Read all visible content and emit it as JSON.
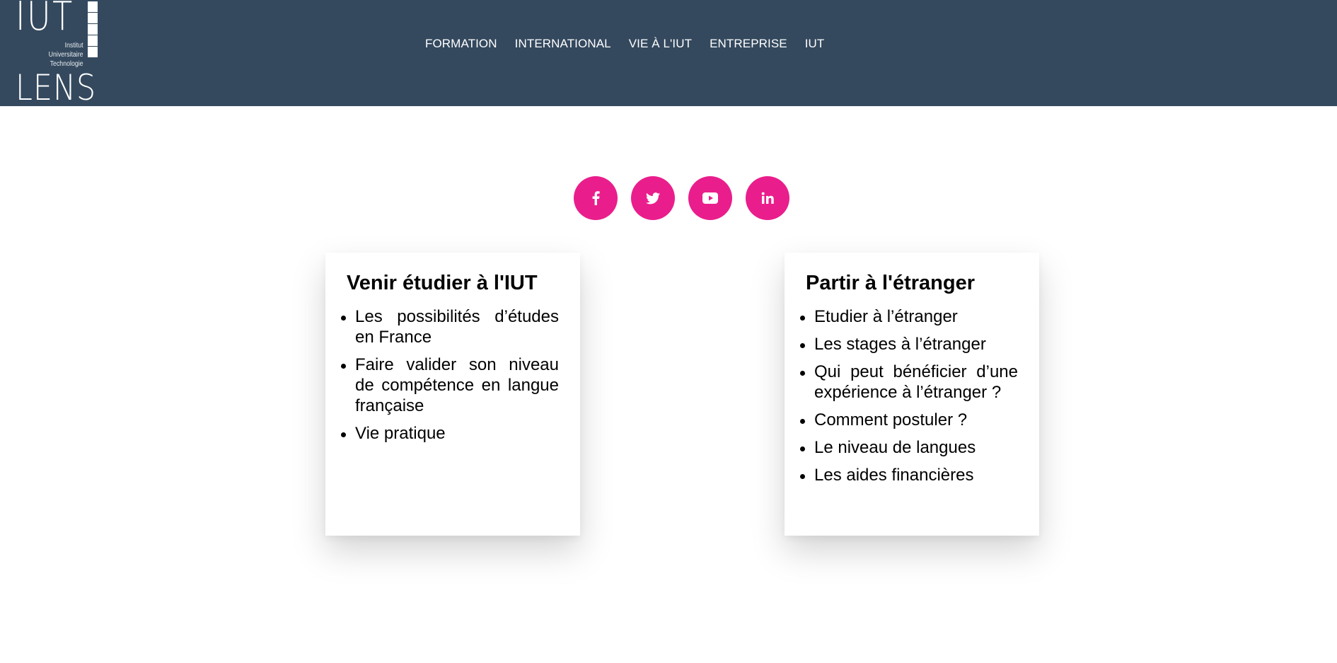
{
  "logo": {
    "top_text": "IUT",
    "subtitle_lines": [
      "Institut",
      "Universitaire",
      "Technologie"
    ],
    "bottom_text": "LENS"
  },
  "nav": {
    "items": [
      {
        "label": "FORMATION"
      },
      {
        "label": "INTERNATIONAL"
      },
      {
        "label": "VIE À L'IUT"
      },
      {
        "label": "ENTREPRISE"
      },
      {
        "label": "IUT"
      }
    ]
  },
  "social": {
    "buttons": [
      {
        "icon": "facebook-icon"
      },
      {
        "icon": "twitter-icon"
      },
      {
        "icon": "youtube-icon"
      },
      {
        "icon": "linkedin-icon"
      }
    ]
  },
  "cards": [
    {
      "title": "Venir étudier à l'IUT",
      "items": [
        "Les possibilités d’études en France",
        "Faire valider son niveau de compétence en langue française",
        "Vie pratique"
      ]
    },
    {
      "title": "Partir à l'étranger",
      "items": [
        "Etudier à l’étranger",
        "Les stages à l’étranger",
        "Qui peut bénéficier d’une expérience à l’étranger ?",
        "Comment postuler ?",
        "Le niveau de langues",
        "Les aides financières"
      ]
    }
  ],
  "colors": {
    "header_bg": "#34495e",
    "accent": "#e91e8c",
    "text": "#000000"
  }
}
